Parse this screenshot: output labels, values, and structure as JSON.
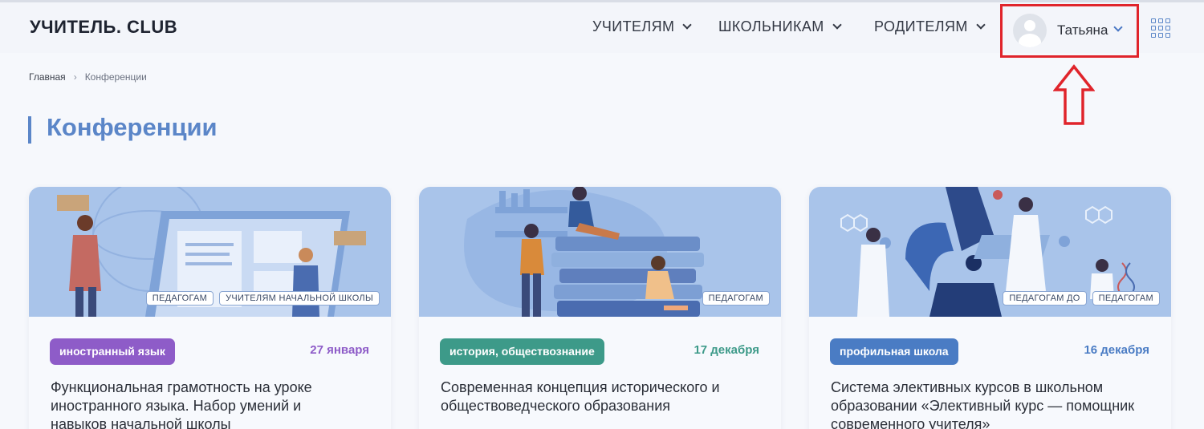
{
  "header": {
    "logo": "УЧИТЕЛЬ. CLUB",
    "nav": [
      {
        "label": "УЧИТЕЛЯМ"
      },
      {
        "label": "ШКОЛЬНИКАМ"
      },
      {
        "label": "РОДИТЕЛЯМ"
      }
    ],
    "user": {
      "name": "Татьяна"
    },
    "highlight_color": "#e0242b"
  },
  "breadcrumb": {
    "home": "Главная",
    "current": "Конференции"
  },
  "page_title": "Конференции",
  "accent_color": "#5b86c8",
  "cards": [
    {
      "tags": [
        "ПЕДАГОГАМ",
        "УЧИТЕЛЯМ НАЧАЛЬНОЙ ШКОЛЫ"
      ],
      "subject": "иностранный язык",
      "subject_color": "#8e5cc8",
      "date": "27 января",
      "title": "Функциональная грамотность на уроке иностранного языка. Набор умений и навыков начальной школы"
    },
    {
      "tags": [
        "ПЕДАГОГАМ"
      ],
      "subject": "история, обществознание",
      "subject_color": "#3d9a89",
      "date": "17 декабря",
      "title": "Современная концепция исторического и обществоведческого образования"
    },
    {
      "tags": [
        "ПЕДАГОГАМ ДО",
        "ПЕДАГОГАМ"
      ],
      "subject": "профильная школа",
      "subject_color": "#4a7cc4",
      "date": "16 декабря",
      "title": "Система элективных курсов в школьном образовании «Элективный курс — помощник современного учителя»"
    }
  ]
}
